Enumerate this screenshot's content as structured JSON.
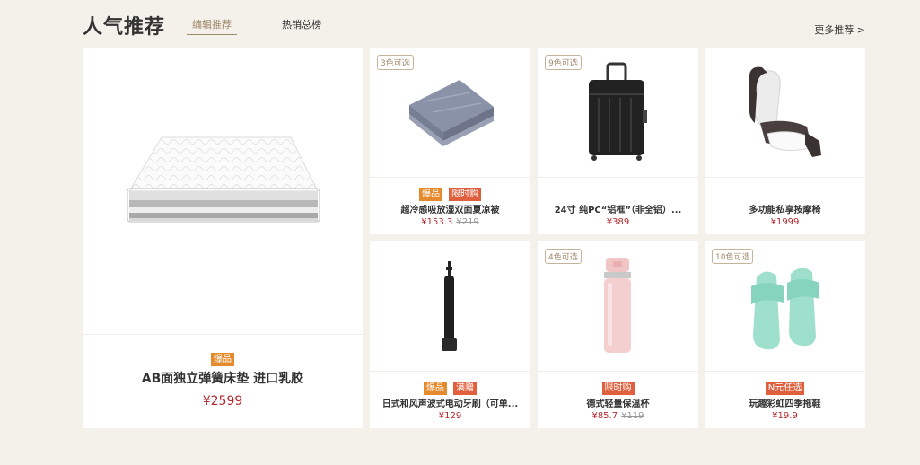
{
  "header": {
    "title": "人气推荐",
    "tabs": [
      {
        "label": "编辑推荐",
        "active": true
      },
      {
        "label": "热销总榜",
        "active": false
      }
    ],
    "more_label": "更多推荐 >"
  },
  "featured": {
    "tags": [
      "爆品"
    ],
    "name": "AB面独立弹簧床垫 进口乳胶",
    "price": "¥2599"
  },
  "products": [
    {
      "color_badge": "3色可选",
      "tags": [
        "爆品",
        "限时购"
      ],
      "name": "超冷感吸放湿双面夏凉被",
      "price": "¥153.3",
      "orig_price": "¥219",
      "icon": "quilt-icon"
    },
    {
      "color_badge": "9色可选",
      "tags": [],
      "name": "24寸 纯PC“铝框”（非全铝）...",
      "price": "¥389",
      "orig_price": "",
      "icon": "suitcase-icon"
    },
    {
      "color_badge": "",
      "tags": [],
      "name": "多功能私享按摩椅",
      "price": "¥1999",
      "orig_price": "",
      "icon": "massage-chair-icon"
    },
    {
      "color_badge": "",
      "tags": [
        "爆品",
        "满赠"
      ],
      "name": "日式和风声波式电动牙刷（可单...",
      "price": "¥129",
      "orig_price": "",
      "icon": "toothbrush-icon"
    },
    {
      "color_badge": "4色可选",
      "tags": [
        "限时购"
      ],
      "name": "德式轻量保温杯",
      "price": "¥85.7",
      "orig_price": "¥119",
      "icon": "thermos-icon"
    },
    {
      "color_badge": "10色可选",
      "tags": [
        "N元任选"
      ],
      "name": "玩趣彩虹四季拖鞋",
      "price": "¥19.9",
      "orig_price": "",
      "icon": "slippers-icon"
    }
  ],
  "colors": {
    "background": "#f4f0ea",
    "accent": "#9f8a6d",
    "price": "#b4282d",
    "tag_hot": "#e68a2e",
    "tag_limited": "#e0603e"
  }
}
